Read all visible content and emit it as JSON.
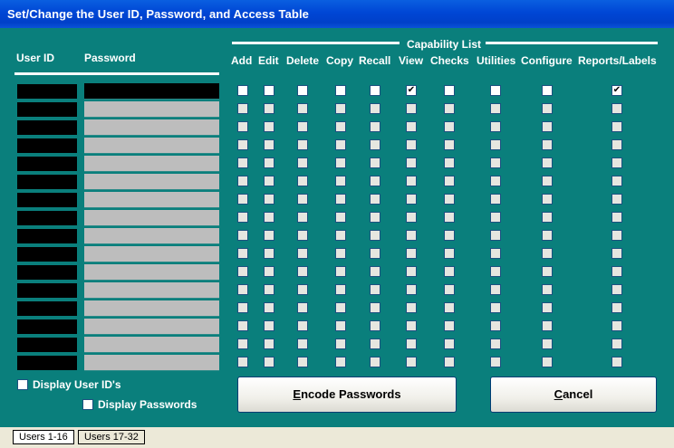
{
  "window": {
    "title": "Set/Change the User ID, Password, and Access Table"
  },
  "columns": {
    "user_id": "User ID",
    "password": "Password",
    "capability_list": "Capability List",
    "capabilities": [
      "Add",
      "Edit",
      "Delete",
      "Copy",
      "Recall",
      "View",
      "Checks",
      "Utilities",
      "Configure",
      "Reports/Labels"
    ]
  },
  "rows": [
    {
      "user_id": "",
      "password": "",
      "checked": [
        "View",
        "Reports/Labels"
      ]
    },
    {
      "user_id": "",
      "password": "",
      "checked": []
    },
    {
      "user_id": "",
      "password": "",
      "checked": []
    },
    {
      "user_id": "",
      "password": "",
      "checked": []
    },
    {
      "user_id": "",
      "password": "",
      "checked": []
    },
    {
      "user_id": "",
      "password": "",
      "checked": []
    },
    {
      "user_id": "",
      "password": "",
      "checked": []
    },
    {
      "user_id": "",
      "password": "",
      "checked": []
    },
    {
      "user_id": "",
      "password": "",
      "checked": []
    },
    {
      "user_id": "",
      "password": "",
      "checked": []
    },
    {
      "user_id": "",
      "password": "",
      "checked": []
    },
    {
      "user_id": "",
      "password": "",
      "checked": []
    },
    {
      "user_id": "",
      "password": "",
      "checked": []
    },
    {
      "user_id": "",
      "password": "",
      "checked": []
    },
    {
      "user_id": "",
      "password": "",
      "checked": []
    },
    {
      "user_id": "",
      "password": "",
      "checked": []
    }
  ],
  "options": {
    "display_user_ids": "Display User ID's",
    "display_passwords": "Display Passwords"
  },
  "buttons": {
    "encode_accel": "E",
    "encode_rest": "ncode Passwords",
    "cancel_accel": "C",
    "cancel_rest": "ancel"
  },
  "tabs": [
    "Users 1-16",
    "Users 17-32"
  ],
  "colors": {
    "background": "#0a7f7c",
    "titlebar": "#0046d5"
  }
}
